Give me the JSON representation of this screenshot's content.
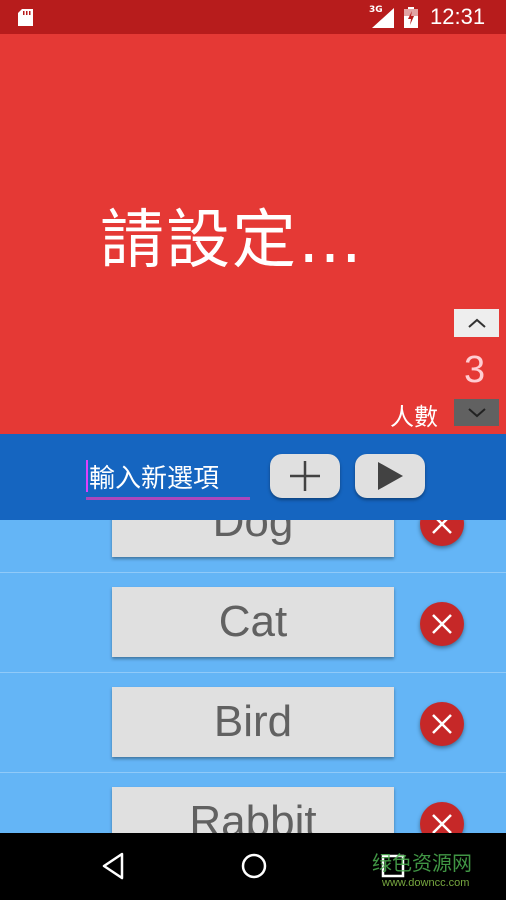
{
  "status_bar": {
    "network": "3G",
    "time": "12:31",
    "icons": [
      "sd-card-icon",
      "signal-icon",
      "battery-charging-icon"
    ]
  },
  "header": {
    "title": "請設定…",
    "count_value": "3",
    "count_label": "人數",
    "background": "#e53935"
  },
  "input_bar": {
    "placeholder": "輸入新選項",
    "add_icon": "plus-icon",
    "play_icon": "play-icon",
    "background": "#1565c0"
  },
  "items": [
    {
      "label": "Dog"
    },
    {
      "label": "Cat"
    },
    {
      "label": "Bird"
    },
    {
      "label": "Rabbit"
    }
  ],
  "list_background": "#64b5f6",
  "nav_bar": {
    "icons": [
      "back-icon",
      "home-icon",
      "recents-icon"
    ]
  },
  "watermark": {
    "text": "绿色资源网",
    "url": "www.downcc.com"
  }
}
